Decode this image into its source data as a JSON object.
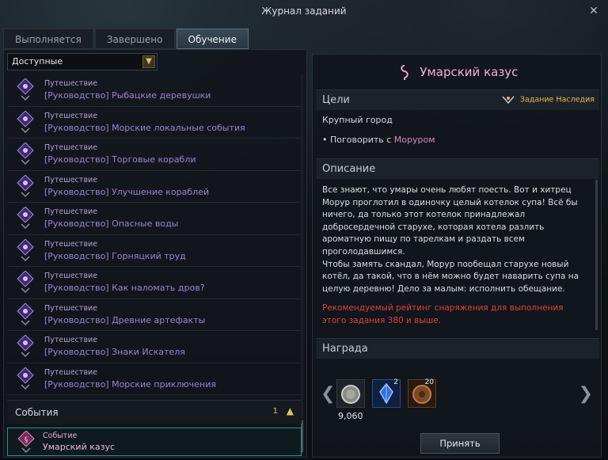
{
  "window": {
    "title": "Журнал заданий",
    "close_label": "✕"
  },
  "tabs": [
    {
      "label": "Выполняется"
    },
    {
      "label": "Завершено"
    },
    {
      "label": "Обучение"
    }
  ],
  "filter": {
    "value": "Доступные"
  },
  "quests": [
    {
      "category": "Путешествие",
      "name": "[Руководство] Рыбацкие деревушки"
    },
    {
      "category": "Путешествие",
      "name": "[Руководство] Морские локальные события"
    },
    {
      "category": "Путешествие",
      "name": "[Руководство] Торговые корабли"
    },
    {
      "category": "Путешествие",
      "name": "[Руководство] Улучшение кораблей"
    },
    {
      "category": "Путешествие",
      "name": "[Руководство] Опасные воды"
    },
    {
      "category": "Путешествие",
      "name": "[Руководство] Горняцкий труд"
    },
    {
      "category": "Путешествие",
      "name": "[Руководство] Как наломать дров?"
    },
    {
      "category": "Путешествие",
      "name": "[Руководство] Древние артефакты"
    },
    {
      "category": "Путешествие",
      "name": "[Руководство] Знаки Искателя"
    },
    {
      "category": "Путешествие",
      "name": "[Руководство] Морские приключения"
    }
  ],
  "events": {
    "label": "События",
    "count": "1",
    "item": {
      "category": "Событие",
      "name": "Умарский казус"
    }
  },
  "detail": {
    "title": "Умарский казус",
    "goals_label": "Цели",
    "legacy_label": "Задание Наследия",
    "goal_city": "Крупный город",
    "goal_task_prefix": "• Поговорить с ",
    "goal_task_npc": "Моруром",
    "description_label": "Описание",
    "description": "Все знают, что умары очень любят поесть. Вот и хитрец\nМорур проглотил в одиночку целый котелок супа! Всё бы\nничего, да только этот котелок принадлежал\nдобросердечной старухе, которая хотела разлить\nароматную пищу по тарелкам и раздать всем\nпроголодавшимся.\nЧтобы замять скандал, Морур пообещал старухе новый\nкотёл, да такой, что в нём можно будет наварить супа на\nцелую деревню! Дело за малым: исполнить обещание.",
    "recommendation": "Рекомендуемый рейтинг снаряжения для выполнения этого задания 380 и выше.",
    "reward_label": "Награда",
    "rewards": [
      {
        "icon": "silver-coin-icon",
        "count": "",
        "quantity": "9,060"
      },
      {
        "icon": "blue-crystal-icon",
        "count": "2"
      },
      {
        "icon": "wooden-token-icon",
        "count": "20"
      }
    ],
    "accept_label": "Принять"
  }
}
